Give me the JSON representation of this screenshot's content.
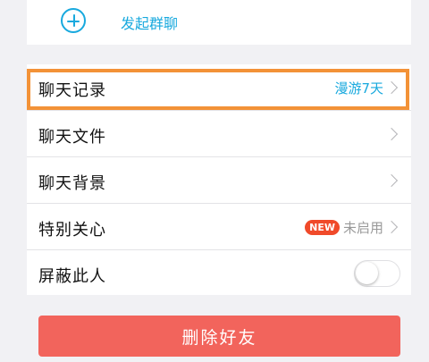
{
  "header": {
    "add_icon": "plus-circle-icon",
    "start_group_label": "发起群聊"
  },
  "settings": {
    "rows": [
      {
        "label": "聊天记录",
        "value": "漫游7天"
      },
      {
        "label": "聊天文件"
      },
      {
        "label": "聊天背景"
      },
      {
        "label": "特别关心",
        "badge": "NEW",
        "value": "未启用"
      },
      {
        "label": "屏蔽此人",
        "toggle_on": false
      }
    ]
  },
  "actions": {
    "delete_friend_label": "删除好友"
  },
  "colors": {
    "accent": "#18a9de",
    "highlight": "#f39237",
    "danger": "#f2645c",
    "badge": "#f04a2a"
  }
}
